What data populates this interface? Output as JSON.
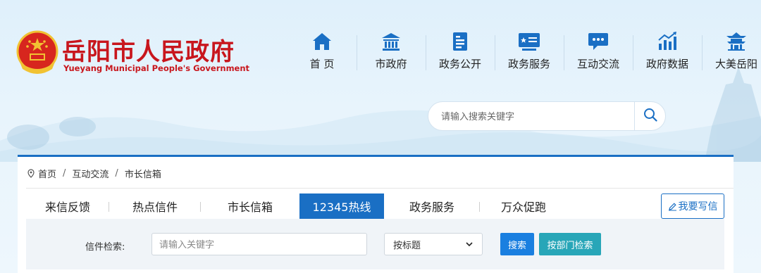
{
  "header": {
    "title": "岳阳市人民政府",
    "subtitle": "Yueyang Municipal People's Government",
    "brand_color": "#c8161d"
  },
  "nav": {
    "items": [
      {
        "label": "首 页",
        "icon": "home-icon"
      },
      {
        "label": "市政府",
        "icon": "government-building-icon"
      },
      {
        "label": "政务公开",
        "icon": "document-icon"
      },
      {
        "label": "政务服务",
        "icon": "service-card-icon"
      },
      {
        "label": "互动交流",
        "icon": "chat-bubble-icon"
      },
      {
        "label": "政府数据",
        "icon": "bar-chart-icon"
      },
      {
        "label": "大美岳阳",
        "icon": "pavilion-icon"
      }
    ]
  },
  "search": {
    "placeholder": "请输入搜索关键字",
    "icon": "search-icon"
  },
  "breadcrumb": {
    "icon": "location-pin-icon",
    "items": [
      "首页",
      "互动交流",
      "市长信箱"
    ],
    "separator": "/"
  },
  "tabs": {
    "items": [
      "来信反馈",
      "热点信件",
      "市长信箱",
      "12345热线",
      "政务服务",
      "万众促跑"
    ],
    "active_index": 3,
    "accent": "#1a6fc4"
  },
  "write_button": {
    "label": "我要写信",
    "icon": "pen-icon"
  },
  "filter": {
    "label": "信件检索:",
    "keyword_placeholder": "请输入关键字",
    "select_value": "按标题",
    "search_label": "搜索",
    "dept_label": "按部门检索",
    "search_color": "#1a7fe0",
    "dept_color": "#28a6b8"
  }
}
